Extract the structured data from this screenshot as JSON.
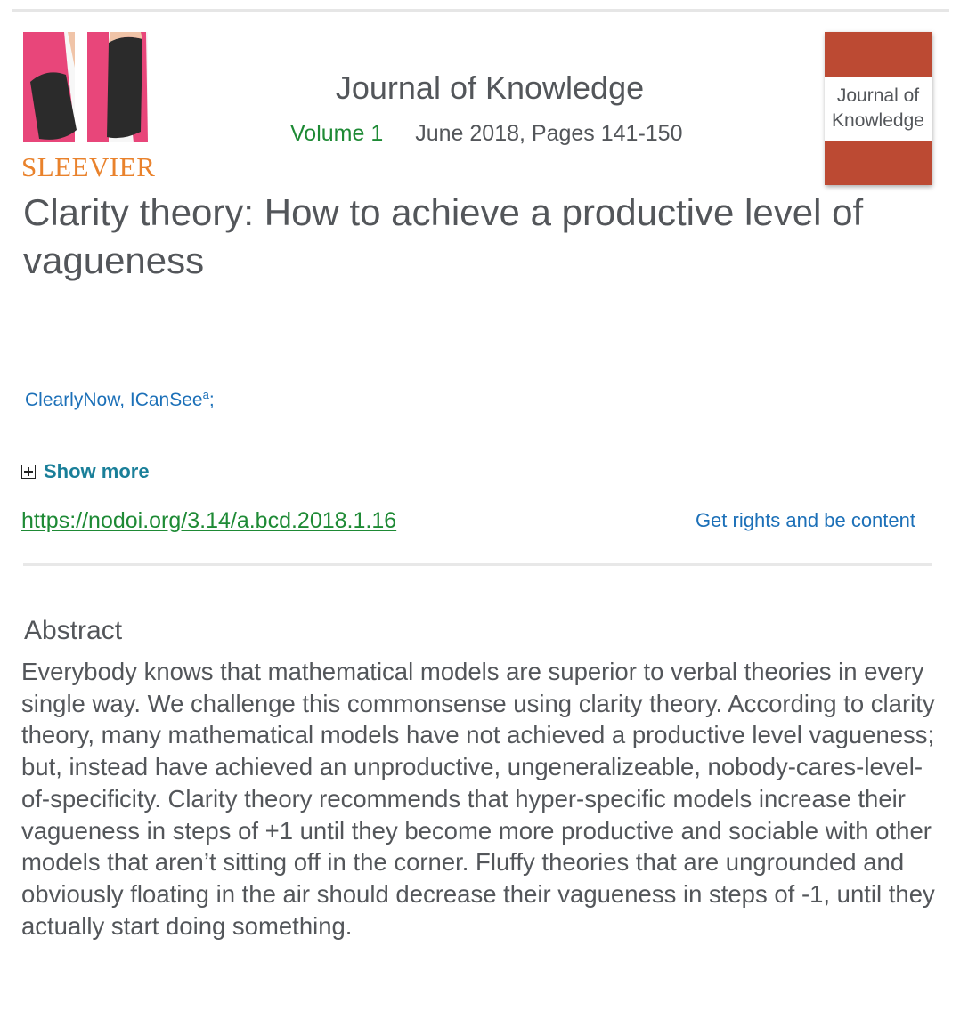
{
  "header": {
    "publisher": "SLEEVIER",
    "journal_title": "Journal of Knowledge",
    "volume": "Volume 1",
    "issue_info": "June 2018, Pages 141-150",
    "cover_title": "Journal of Knowledge"
  },
  "article": {
    "title": "Clarity theory: How to achieve a productive level of vagueness",
    "authors": "ClearlyNow, ICanSee",
    "author_affiliation_mark": "a",
    "author_separator": ";",
    "show_more_label": "Show more",
    "doi": "https://nodoi.org/3.14/a.bcd.2018.1.16",
    "rights_label": "Get rights and be content"
  },
  "abstract": {
    "heading": "Abstract",
    "text": "Everybody knows that mathematical models are superior to verbal theories in every single way. We challenge this commonsense using clarity theory. According to clarity theory, many mathematical models have not achieved a productive level vagueness; but, instead have achieved an unproductive, ungeneralizeable, nobody-cares-level-of-specificity. Clarity theory recommends that hyper-specific models increase their vagueness in steps of +1 until they become more productive and sociable with other models that aren’t sitting off in the corner. Fluffy theories that are ungrounded and obviously floating in the air should decrease their vagueness in steps of -1, until they actually start doing something."
  },
  "colors": {
    "text": "#53565a",
    "publisher_orange": "#e9822c",
    "link_green": "#1e8a35",
    "link_blue": "#1c70b8",
    "show_more_teal": "#1a7f99",
    "cover_red": "#bc4a33",
    "sleeve_pink": "#e8467a",
    "sleeve_black": "#2b2b2b"
  },
  "icons": {
    "show_more": "plus-square-icon"
  }
}
